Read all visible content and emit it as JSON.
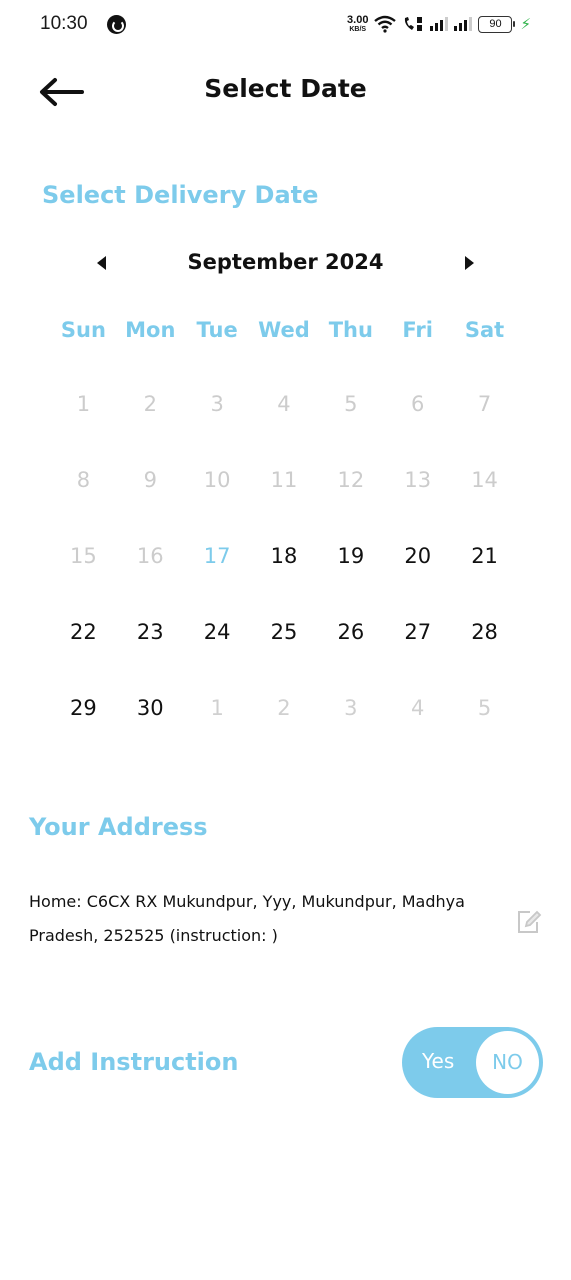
{
  "status_bar": {
    "time": "10:30",
    "net_speed_value": "3.00",
    "net_speed_unit": "KB/S",
    "battery": "90"
  },
  "header": {
    "title": "Select Date",
    "back_icon": "arrow-left-icon"
  },
  "delivery": {
    "section_title": "Select Delivery Date",
    "calendar": {
      "month_label": "September 2024",
      "prev_icon": "caret-left-icon",
      "next_icon": "caret-right-icon",
      "weekdays": [
        "Sun",
        "Mon",
        "Tue",
        "Wed",
        "Thu",
        "Fri",
        "Sat"
      ],
      "days": [
        {
          "label": "1",
          "state": "disabled"
        },
        {
          "label": "2",
          "state": "disabled"
        },
        {
          "label": "3",
          "state": "disabled"
        },
        {
          "label": "4",
          "state": "disabled"
        },
        {
          "label": "5",
          "state": "disabled"
        },
        {
          "label": "6",
          "state": "disabled"
        },
        {
          "label": "7",
          "state": "disabled"
        },
        {
          "label": "8",
          "state": "disabled"
        },
        {
          "label": "9",
          "state": "disabled"
        },
        {
          "label": "10",
          "state": "disabled"
        },
        {
          "label": "11",
          "state": "disabled"
        },
        {
          "label": "12",
          "state": "disabled"
        },
        {
          "label": "13",
          "state": "disabled"
        },
        {
          "label": "14",
          "state": "disabled"
        },
        {
          "label": "15",
          "state": "disabled"
        },
        {
          "label": "16",
          "state": "disabled"
        },
        {
          "label": "17",
          "state": "today"
        },
        {
          "label": "18",
          "state": "enabled"
        },
        {
          "label": "19",
          "state": "enabled"
        },
        {
          "label": "20",
          "state": "enabled"
        },
        {
          "label": "21",
          "state": "enabled"
        },
        {
          "label": "22",
          "state": "enabled"
        },
        {
          "label": "23",
          "state": "enabled"
        },
        {
          "label": "24",
          "state": "enabled"
        },
        {
          "label": "25",
          "state": "enabled"
        },
        {
          "label": "26",
          "state": "enabled"
        },
        {
          "label": "27",
          "state": "enabled"
        },
        {
          "label": "28",
          "state": "enabled"
        },
        {
          "label": "29",
          "state": "enabled"
        },
        {
          "label": "30",
          "state": "enabled"
        },
        {
          "label": "1",
          "state": "other"
        },
        {
          "label": "2",
          "state": "other"
        },
        {
          "label": "3",
          "state": "other"
        },
        {
          "label": "4",
          "state": "other"
        },
        {
          "label": "5",
          "state": "other"
        }
      ]
    }
  },
  "address": {
    "section_title": "Your Address",
    "text": "Home: C6CX RX Mukundpur, Yyy, Mukundpur, Madhya Pradesh, 252525 (instruction: )",
    "edit_icon": "edit-icon"
  },
  "instruction": {
    "label": "Add Instruction",
    "toggle_yes": "Yes",
    "toggle_no": "NO",
    "selected": "NO"
  },
  "colors": {
    "accent": "#7dcbeb",
    "disabled_text": "#cccccc",
    "primary_text": "#111111"
  }
}
